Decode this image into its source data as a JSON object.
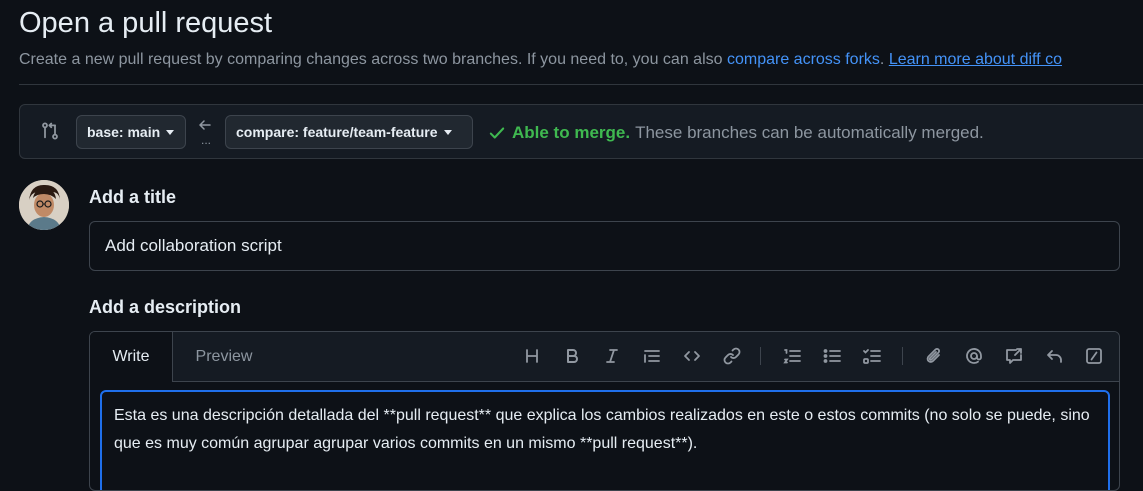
{
  "page": {
    "title": "Open a pull request",
    "subtitle_text": "Create a new pull request by comparing changes across two branches. If you need to, you can also",
    "compare_forks_link": "compare across forks",
    "subtitle_period": ".",
    "learn_more_link": "Learn more about diff co"
  },
  "compare": {
    "base_label": "base: main",
    "compare_label": "compare: feature/team-feature",
    "dots": "...",
    "merge_ok": "Able to merge.",
    "merge_msg": "These branches can be automatically merged."
  },
  "form": {
    "title_label": "Add a title",
    "title_value": "Add collaboration script",
    "description_label": "Add a description",
    "tabs": [
      {
        "label": "Write",
        "active": true
      },
      {
        "label": "Preview",
        "active": false
      }
    ],
    "toolbar_icons": [
      "heading-icon",
      "bold-icon",
      "italic-icon",
      "quote-icon",
      "code-icon",
      "link-icon",
      "ordered-list-icon",
      "unordered-list-icon",
      "task-list-icon",
      "attach-icon",
      "mention-icon",
      "reference-icon",
      "undo-icon",
      "slash-command-icon"
    ],
    "description_value": "Esta es una descripción detallada del **pull request** que explica los cambios realizados en este o estos commits (no solo se puede, sino que es muy común agrupar agrupar varios commits en un mismo **pull request**)."
  },
  "colors": {
    "background": "#0d1117",
    "accent_link": "#4493f8",
    "success": "#3fb950",
    "focus_border": "#1f6feb"
  }
}
